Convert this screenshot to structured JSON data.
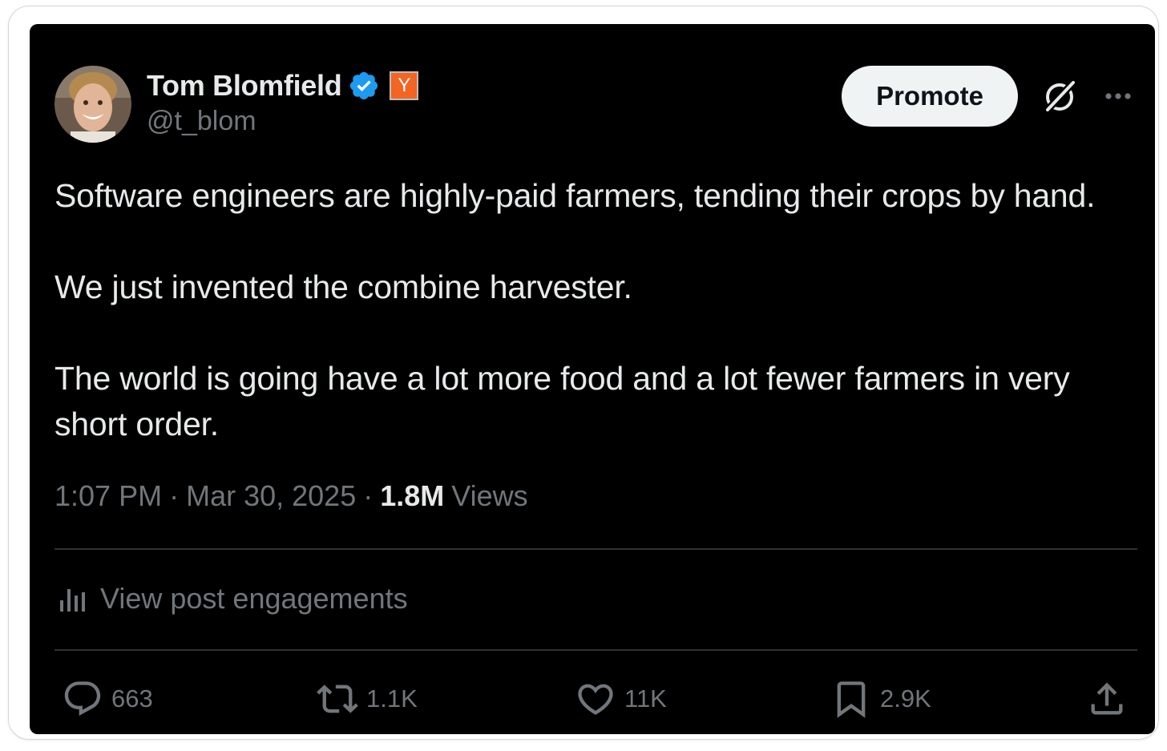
{
  "author": {
    "name": "Tom Blomfield",
    "handle": "@t_blom",
    "badge_label": "Y",
    "badge_color": "#f26522",
    "verified_color": "#1d9bf0",
    "avatar_icon": "avatar-photo"
  },
  "header": {
    "promote_label": "Promote",
    "grok_icon": "grok-slash-icon",
    "more_icon": "more-dots-icon"
  },
  "tweet": {
    "paragraphs": [
      "Software engineers are highly-paid farmers, tending their crops by hand.",
      "We just invented the combine harvester.",
      "The world is going have a lot more food and a lot fewer farmers in very short order."
    ],
    "time": "1:07 PM",
    "date": "Mar 30, 2025",
    "views_count": "1.8M",
    "views_label": "Views",
    "separator": "·"
  },
  "engagements": {
    "label": "View post engagements",
    "icon": "bar-chart-icon"
  },
  "actions": {
    "replies": "663",
    "reposts": "1.1K",
    "likes": "11K",
    "bookmarks": "2.9K"
  },
  "colors": {
    "card_background": "#000000",
    "text_primary": "#e7e9ea",
    "text_secondary": "#71767b",
    "divider": "#2f3336"
  }
}
